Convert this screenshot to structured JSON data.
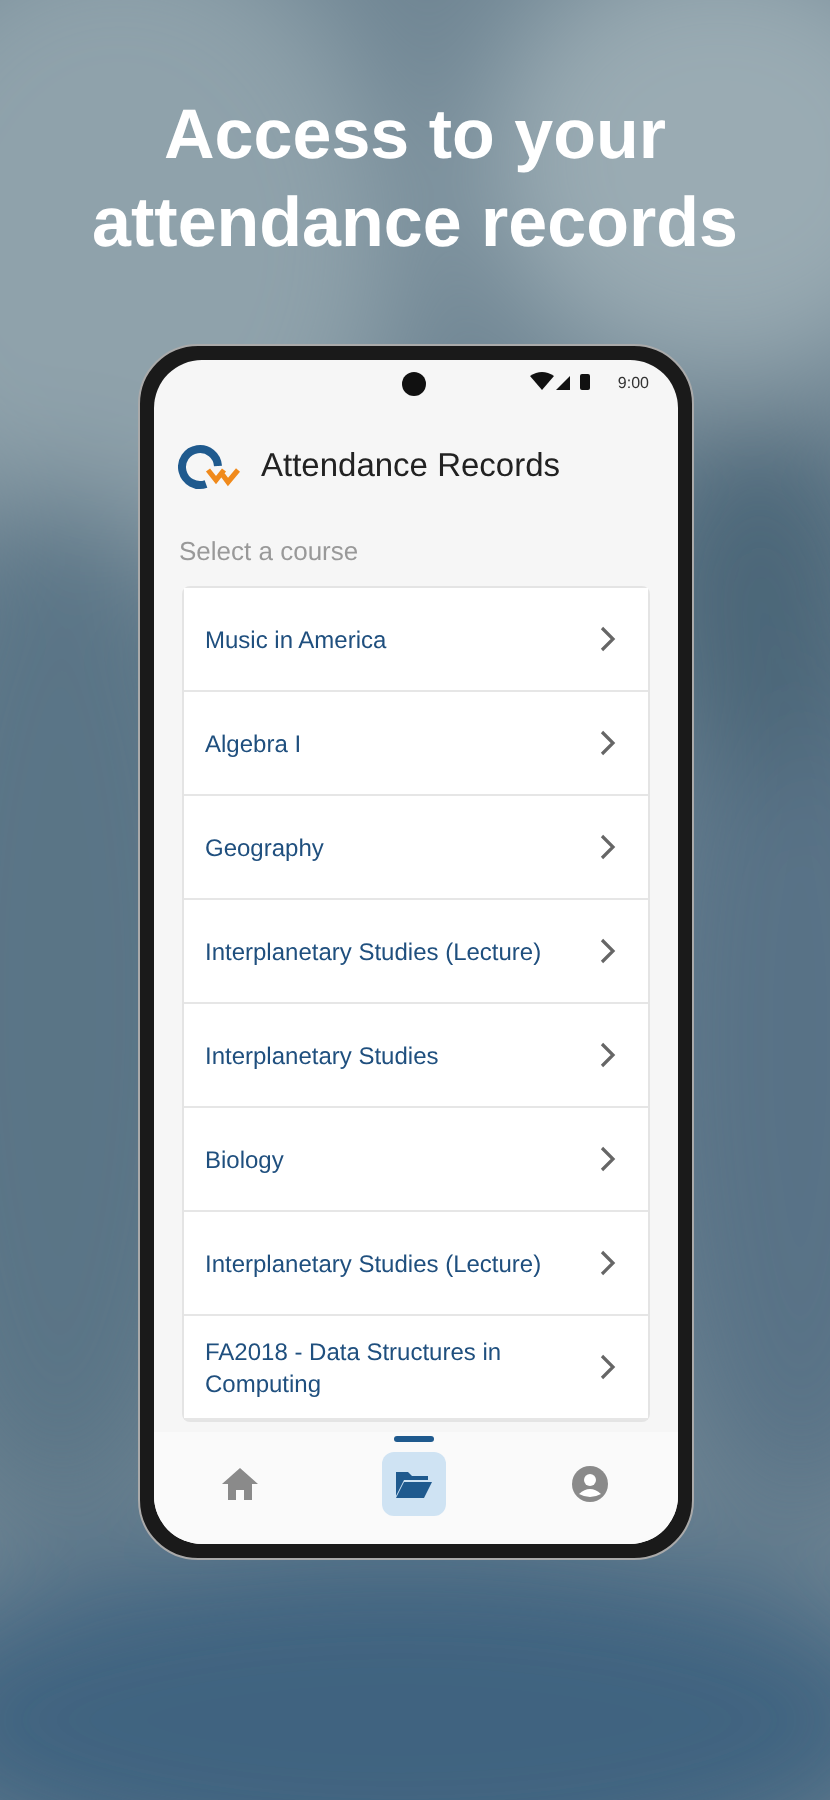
{
  "headline": "Access to your attendance records",
  "status_bar": {
    "time": "9:00"
  },
  "app_bar": {
    "title": "Attendance Records"
  },
  "section_label": "Select a course",
  "courses": [
    {
      "name": "Music in America"
    },
    {
      "name": "Algebra I"
    },
    {
      "name": "Geography"
    },
    {
      "name": "Interplanetary Studies (Lecture)"
    },
    {
      "name": "Interplanetary Studies"
    },
    {
      "name": "Biology"
    },
    {
      "name": "Interplanetary Studies (Lecture)"
    },
    {
      "name": "FA2018 - Data Structures in Computing"
    }
  ],
  "nav": [
    {
      "kind": "home",
      "selected": false
    },
    {
      "kind": "folder",
      "selected": true
    },
    {
      "kind": "profile",
      "selected": false
    }
  ]
}
